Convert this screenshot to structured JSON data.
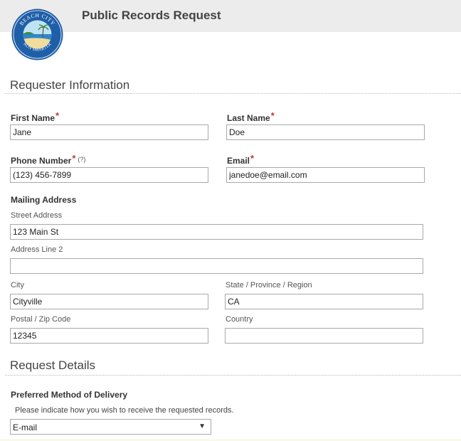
{
  "app": {
    "title": "Public Records Request"
  },
  "logo": {
    "top_text": "BEACH CITY",
    "bottom_text": "RUN SMARTER"
  },
  "sections": {
    "requester": "Requester Information",
    "details": "Request Details"
  },
  "requester": {
    "first_name": {
      "label": "First Name",
      "required": "*",
      "value": "Jane"
    },
    "last_name": {
      "label": "Last Name",
      "required": "*",
      "value": "Doe"
    },
    "phone": {
      "label": "Phone Number",
      "required": "*",
      "help": "(?)",
      "value": "(123) 456-7899"
    },
    "email": {
      "label": "Email",
      "required": "*",
      "value": "janedoe@email.com"
    }
  },
  "address": {
    "label": "Mailing Address",
    "street": {
      "label": "Street Address",
      "value": "123 Main St"
    },
    "line2": {
      "label": "Address Line 2",
      "value": ""
    },
    "city": {
      "label": "City",
      "value": "Cityville"
    },
    "state": {
      "label": "State / Province / Region",
      "value": "CA"
    },
    "postal": {
      "label": "Postal / Zip Code",
      "value": "12345"
    },
    "country": {
      "label": "Country",
      "value": ""
    }
  },
  "delivery": {
    "label": "Preferred Method of Delivery",
    "note": "Please indicate how you wish to receive the requested records.",
    "selected": "E-mail",
    "arrow": "▼"
  },
  "colors": {
    "header_bg": "#ececec",
    "required": "#c0392b",
    "logo_ring": "#1f5fa8"
  },
  "icons": {
    "logo": "beach-city-seal-icon",
    "dropdown": "chevron-down-icon"
  }
}
